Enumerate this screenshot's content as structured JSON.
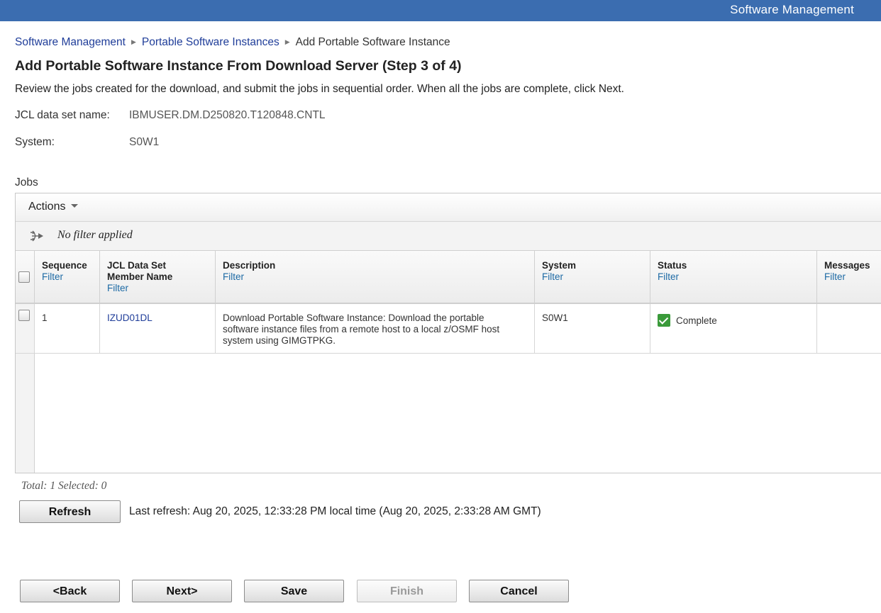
{
  "app_title": "Software Management",
  "breadcrumb": {
    "items": [
      "Software Management",
      "Portable Software Instances"
    ],
    "current": "Add Portable Software Instance"
  },
  "page": {
    "title": "Add Portable Software Instance From Download Server (Step 3 of 4)",
    "intro": "Review the jobs created for the download, and submit the jobs in sequential order. When all the jobs are complete, click Next."
  },
  "fields": {
    "jcl_label": "JCL data set name:",
    "jcl_value": "IBMUSER.DM.D250820.T120848.CNTL",
    "system_label": "System:",
    "system_value": "S0W1"
  },
  "jobs": {
    "label": "Jobs",
    "actions_label": "Actions",
    "filter_status": "No filter applied",
    "filter_link": "Filter",
    "columns": [
      "Sequence",
      "JCL Data Set Member Name",
      "Description",
      "System",
      "Status",
      "Messages"
    ],
    "rows": [
      {
        "sequence": "1",
        "member": "IZUD01DL",
        "description": "Download Portable Software Instance:  Download the portable software instance files from a remote host to a local z/OSMF host system using GIMGTPKG.",
        "system": "S0W1",
        "status": "Complete",
        "messages": ""
      }
    ],
    "footer": "Total: 1 Selected: 0"
  },
  "refresh": {
    "button": "Refresh",
    "text": "Last refresh: Aug 20, 2025, 12:33:28 PM local time (Aug 20, 2025, 2:33:28 AM GMT)"
  },
  "nav_buttons": {
    "back": "<Back",
    "next": "Next>",
    "save": "Save",
    "finish": "Finish",
    "cancel": "Cancel"
  },
  "colors": {
    "header_bar": "#3b6db0",
    "link": "#1f3d99",
    "filter_link": "#1d6aa5",
    "status_complete": "#3a9a3a"
  }
}
